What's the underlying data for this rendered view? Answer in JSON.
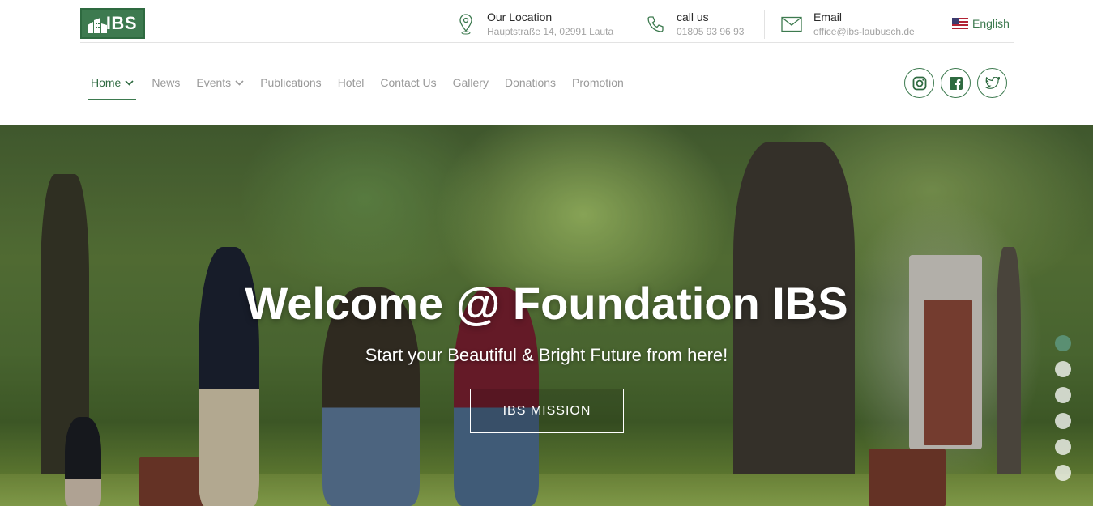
{
  "brand": {
    "logo_text": "IBS",
    "accent_color": "#3d7a4f"
  },
  "contact": {
    "location": {
      "icon": "location-pin-icon",
      "title": "Our Location",
      "value": "Hauptstraße 14, 02991 Lauta"
    },
    "phone": {
      "icon": "phone-icon",
      "title": "call us",
      "value": "01805 93 96 93"
    },
    "email": {
      "icon": "envelope-icon",
      "title": "Email",
      "value": "office@ibs-laubusch.de"
    }
  },
  "language": {
    "icon": "us-flag-icon",
    "label": "English"
  },
  "nav": {
    "items": [
      {
        "label": "Home",
        "has_dropdown": true,
        "active": true
      },
      {
        "label": "News",
        "has_dropdown": false
      },
      {
        "label": "Events",
        "has_dropdown": true
      },
      {
        "label": "Publications",
        "has_dropdown": false
      },
      {
        "label": "Hotel",
        "has_dropdown": false
      },
      {
        "label": "Contact Us",
        "has_dropdown": false
      },
      {
        "label": "Gallery",
        "has_dropdown": false
      },
      {
        "label": "Donations",
        "has_dropdown": false
      },
      {
        "label": "Promotion",
        "has_dropdown": false
      }
    ]
  },
  "social": [
    "instagram-icon",
    "facebook-icon",
    "twitter-icon"
  ],
  "hero": {
    "title": "Welcome @ Foundation IBS",
    "subtitle": "Start your Beautiful & Bright Future from here!",
    "button_label": "IBS MISSION",
    "slide_count": 6,
    "active_slide": 1
  }
}
